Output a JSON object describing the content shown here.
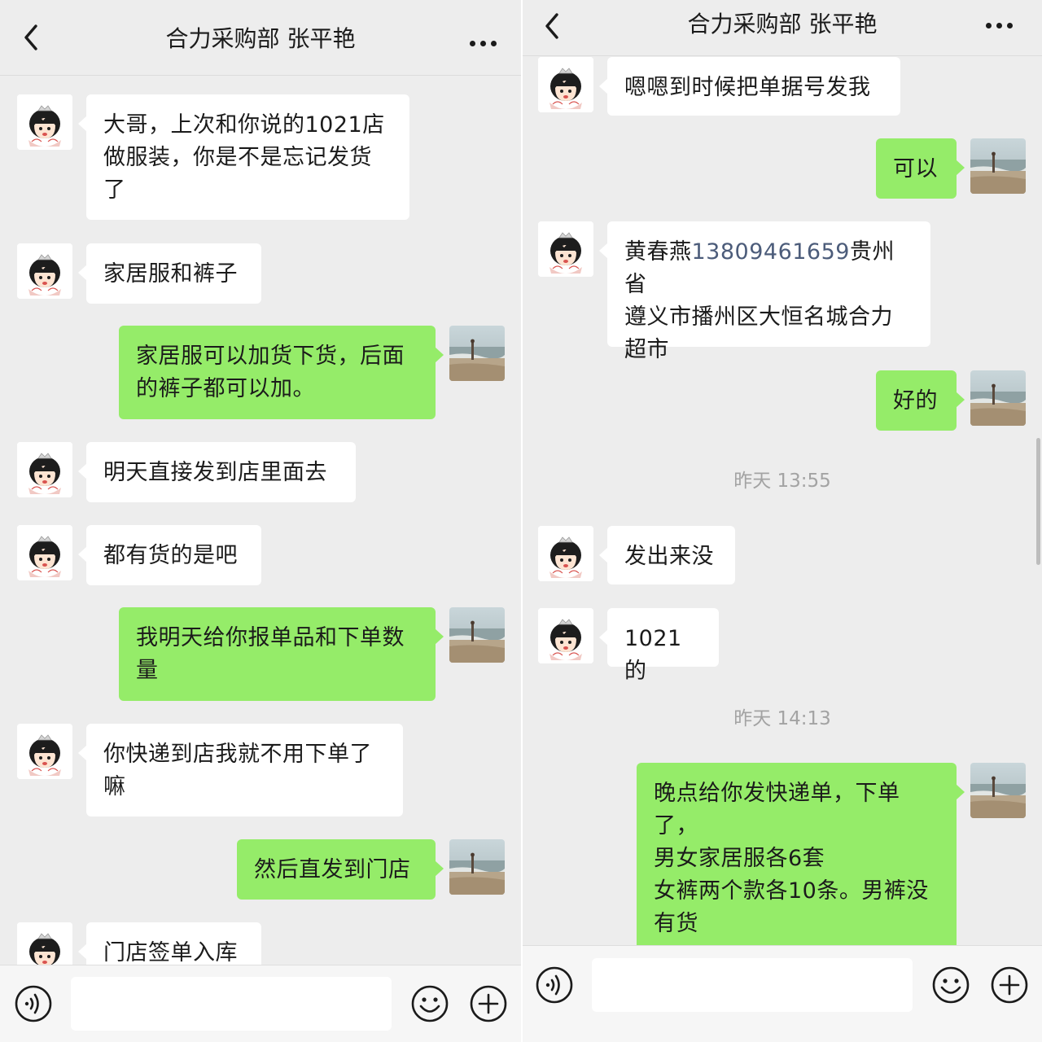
{
  "left": {
    "title": "合力采购部 张平艳",
    "messages": [
      {
        "dir": "in",
        "text": "大哥，上次和你说的1021店\n做服装，你是不是忘记发货\n了"
      },
      {
        "dir": "in",
        "text": "家居服和裤子"
      },
      {
        "dir": "out",
        "text": "家居服可以加货下货，后面\n的裤子都可以加。"
      },
      {
        "dir": "in",
        "text": "明天直接发到店里面去"
      },
      {
        "dir": "in",
        "text": "都有货的是吧"
      },
      {
        "dir": "out",
        "text": "我明天给你报单品和下单数\n量"
      },
      {
        "dir": "in",
        "text": "你快递到店我就不用下单了\n嘛"
      },
      {
        "dir": "out",
        "text": "然后直发到门店"
      },
      {
        "dir": "in",
        "text": "门店签单入库"
      }
    ]
  },
  "right": {
    "title": "合力采购部 张平艳",
    "messages": [
      {
        "dir": "in",
        "text": "嗯嗯到时候把单据号发我"
      },
      {
        "dir": "out",
        "text": "可以"
      },
      {
        "dir": "in",
        "name": "黄春燕",
        "phone": "13809461659",
        "text_rest": "贵州省\n遵义市播州区大恒名城合力\n超市"
      },
      {
        "dir": "out",
        "text": "好的"
      },
      {
        "dir": "in",
        "text": "发出来没"
      },
      {
        "dir": "in",
        "text": "1021的"
      },
      {
        "dir": "out",
        "text": "晚点给你发快递单，下单\n了，\n男女家居服各6套\n女裤两个款各10条。男裤没\n有货"
      }
    ],
    "timestamps": [
      "昨天 13:55",
      "昨天 14:13"
    ]
  },
  "icons": {
    "back": "chevron-left-icon",
    "more": "more-dots-icon",
    "voice": "voice-icon",
    "emoji": "emoji-icon",
    "plus": "plus-icon",
    "contact_avatar": "cartoon-girl-avatar",
    "self_avatar": "beach-photo-avatar"
  },
  "colors": {
    "outgoing_bubble": "#95ec69",
    "incoming_bubble": "#ffffff",
    "background": "#ededed",
    "phone_link": "#4c5c7a"
  }
}
